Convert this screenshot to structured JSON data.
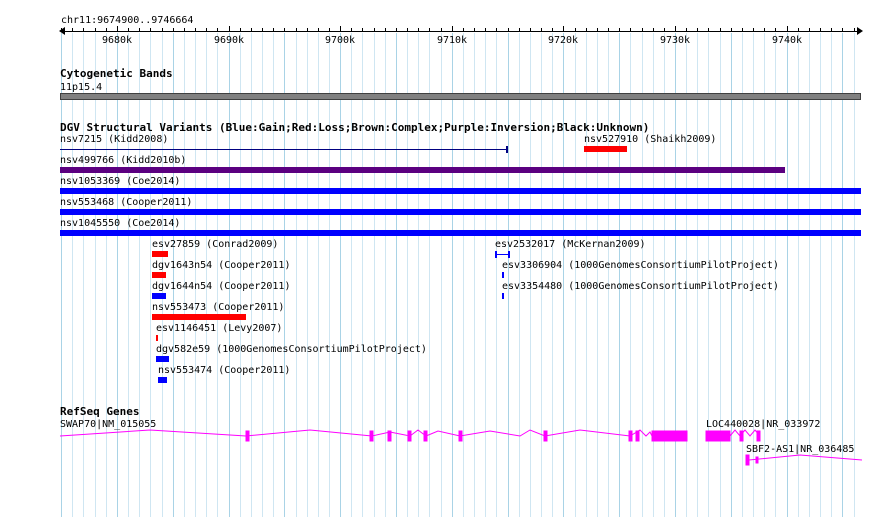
{
  "ruler": {
    "location": "chr11:9674900..9746664",
    "ticks": [
      "9680k",
      "9690k",
      "9700k",
      "9710k",
      "9720k",
      "9730k",
      "9740k"
    ]
  },
  "tracks": {
    "cytoband": {
      "title": "Cytogenetic Bands",
      "band_label": "11p15.4",
      "color": "#808080"
    },
    "dgv": {
      "title": "DGV Structural Variants (Blue:Gain;Red:Loss;Brown:Complex;Purple:Inversion;Black:Unknown)",
      "colors": {
        "gain": "#0000ff",
        "loss": "#ff0000",
        "inversion": "#5b0080",
        "unknown": "#000080"
      },
      "features": [
        {
          "label": "nsv7215 (Kidd2008)",
          "type": "unknown"
        },
        {
          "label": "nsv527910 (Shaikh2009)",
          "type": "loss"
        },
        {
          "label": "nsv499766 (Kidd2010b)",
          "type": "inversion"
        },
        {
          "label": "nsv1053369 (Coe2014)",
          "type": "gain"
        },
        {
          "label": "nsv553468 (Cooper2011)",
          "type": "gain"
        },
        {
          "label": "nsv1045550 (Coe2014)",
          "type": "gain"
        },
        {
          "label": "esv27859 (Conrad2009)",
          "type": "loss"
        },
        {
          "label": "esv2532017 (McKernan2009)",
          "type": "gain"
        },
        {
          "label": "dgv1643n54 (Cooper2011)",
          "type": "loss"
        },
        {
          "label": "esv3306904 (1000GenomesConsortiumPilotProject)",
          "type": "gain"
        },
        {
          "label": "dgv1644n54 (Cooper2011)",
          "type": "gain"
        },
        {
          "label": "esv3354480 (1000GenomesConsortiumPilotProject)",
          "type": "gain"
        },
        {
          "label": "nsv553473 (Cooper2011)",
          "type": "loss"
        },
        {
          "label": "esv1146451 (Levy2007)",
          "type": "loss"
        },
        {
          "label": "dgv582e59 (1000GenomesConsortiumPilotProject)",
          "type": "gain"
        },
        {
          "label": "nsv553474 (Cooper2011)",
          "type": "gain"
        }
      ]
    },
    "refseq": {
      "title": "RefSeq Genes",
      "color": "#ff00ff",
      "genes": [
        {
          "label": "SWAP70|NM_015055"
        },
        {
          "label": "LOC440028|NR_033972"
        },
        {
          "label": "SBF2-AS1|NR_036485"
        }
      ]
    }
  }
}
